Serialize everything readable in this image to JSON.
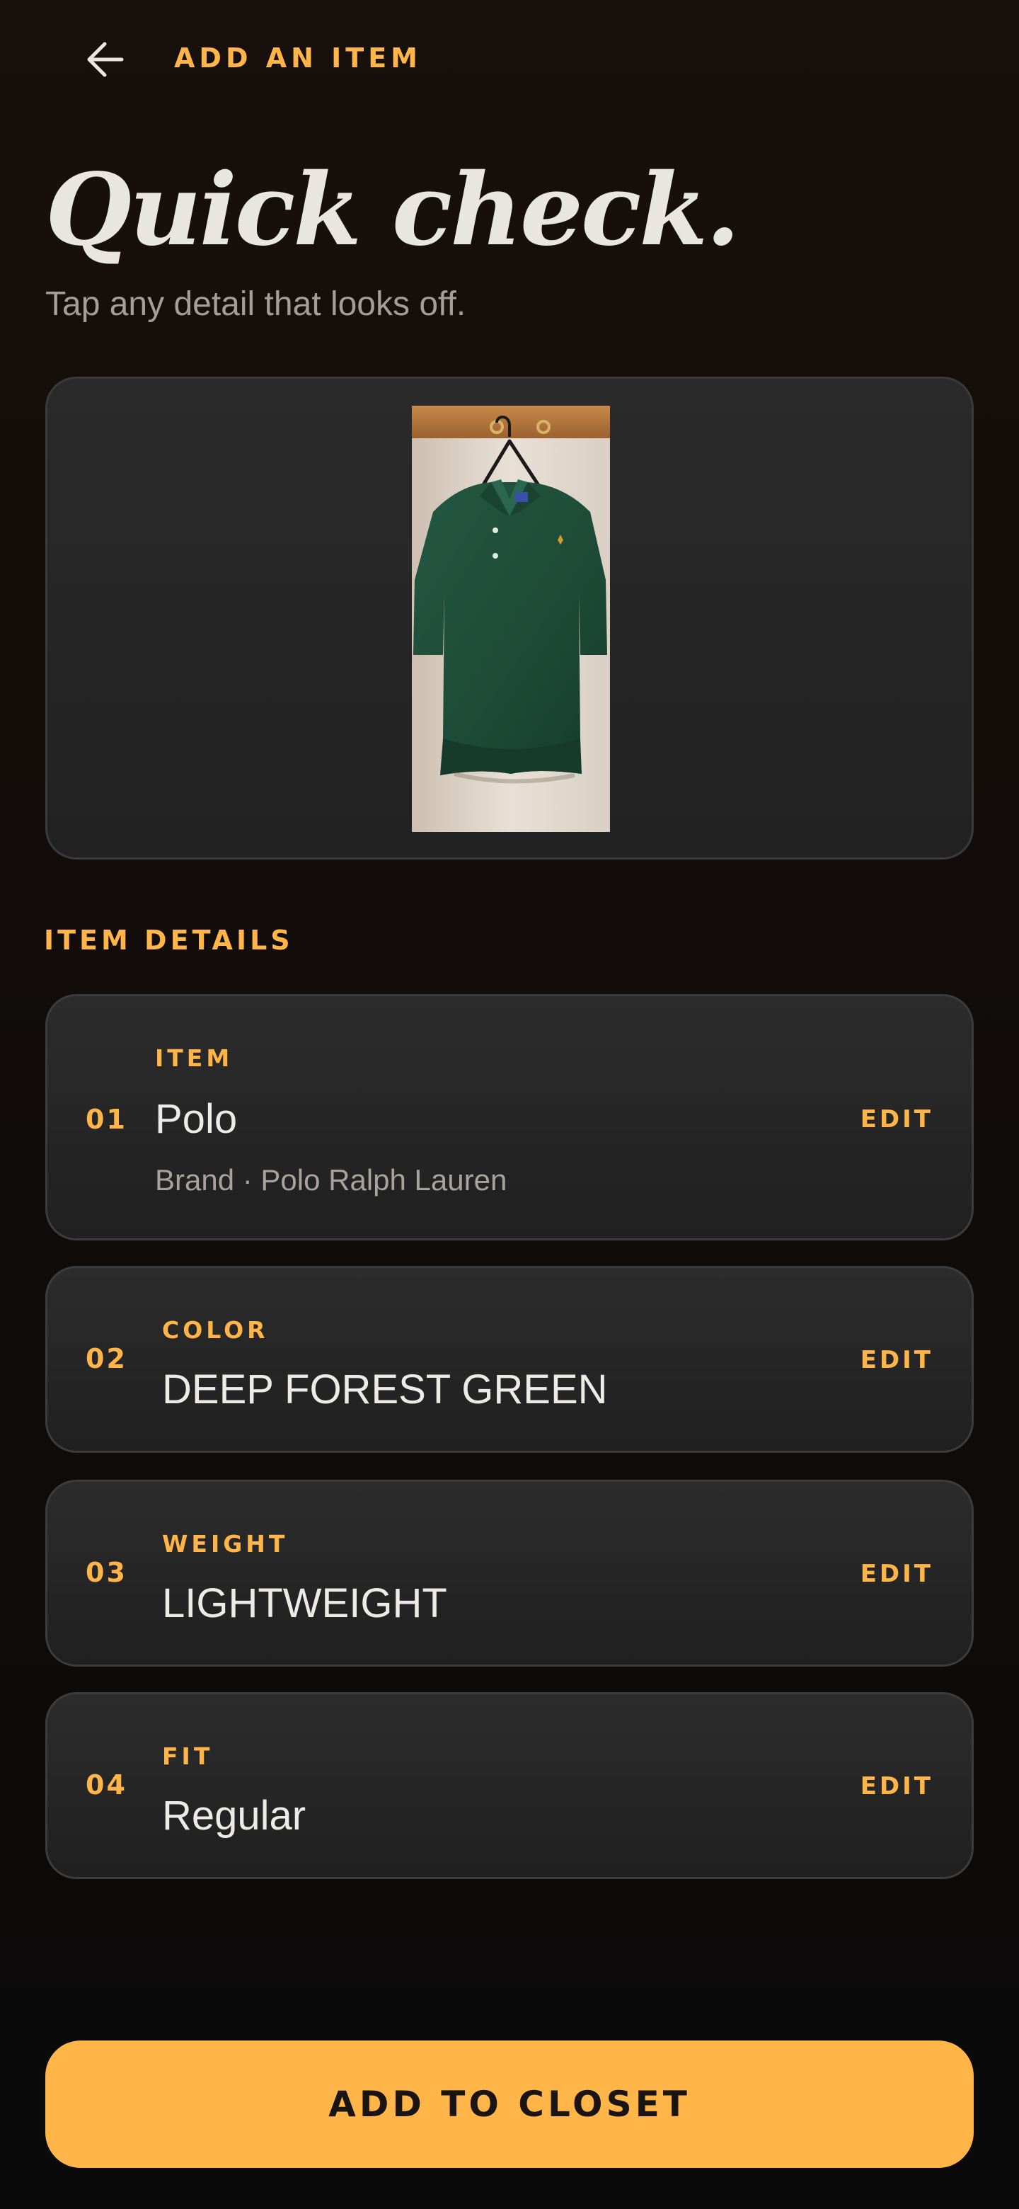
{
  "header": {
    "back_icon": "arrow-left-icon",
    "title": "ADD AN ITEM"
  },
  "hero": {
    "title": "Quick check.",
    "subtitle": "Tap any detail that looks off."
  },
  "photo": {
    "subject": "green polo shirt on hanger",
    "shirt_color": "#1f4a36",
    "background_color": "#e6ddd3"
  },
  "details_section": {
    "label": "ITEM DETAILS",
    "items": [
      {
        "num": "01",
        "label": "ITEM",
        "value": "Polo",
        "meta": "Brand · Polo Ralph Lauren",
        "edit": "EDIT"
      },
      {
        "num": "02",
        "label": "COLOR",
        "value": "DEEP FOREST GREEN",
        "edit": "EDIT"
      },
      {
        "num": "03",
        "label": "WEIGHT",
        "value": "LIGHTWEIGHT",
        "edit": "EDIT"
      },
      {
        "num": "04",
        "label": "FIT",
        "value": "Regular",
        "edit": "EDIT"
      }
    ]
  },
  "cta": {
    "label": "ADD TO CLOSET"
  },
  "colors": {
    "accent": "#ffb547",
    "background": "#120d0a",
    "card": "#262626",
    "text_primary": "#e9e6e2",
    "text_secondary": "#a29e99"
  }
}
